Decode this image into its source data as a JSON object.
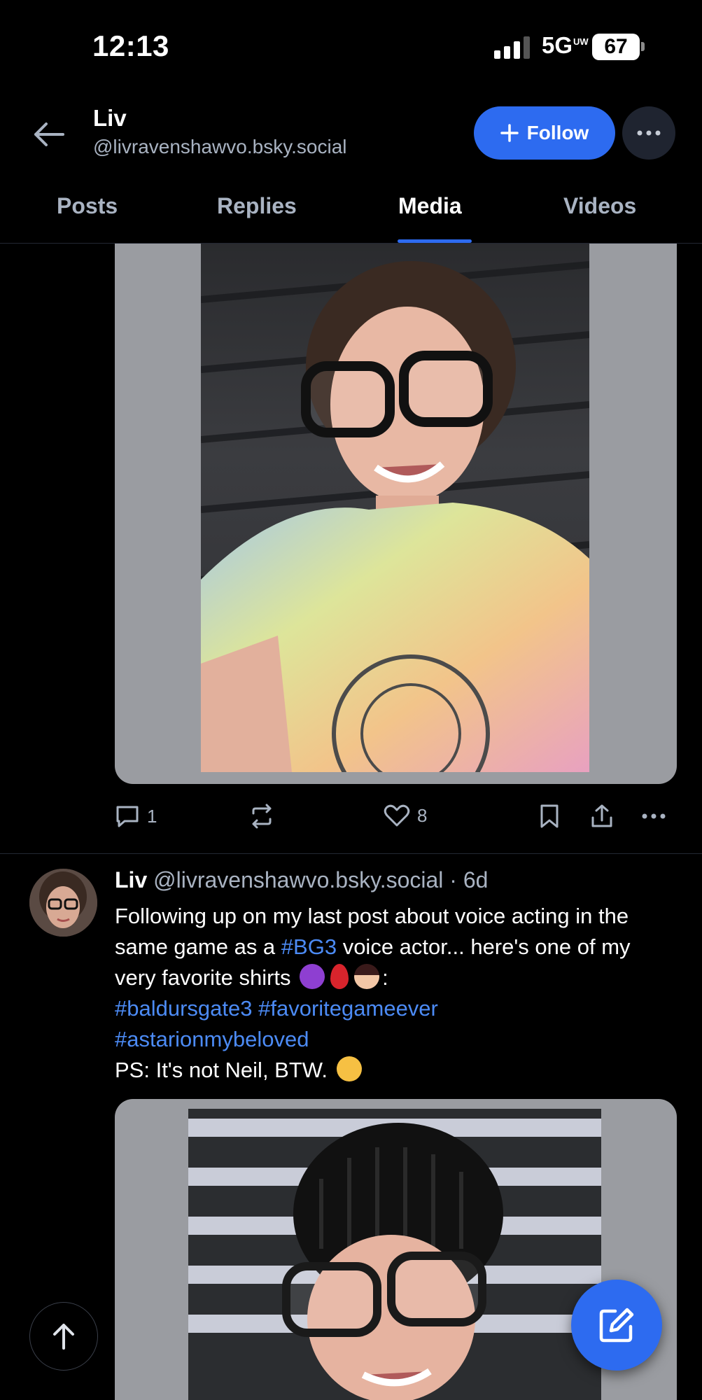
{
  "status_bar": {
    "time": "12:13",
    "network": "5G",
    "network_sup": "UW",
    "battery": "67"
  },
  "header": {
    "name": "Liv",
    "handle": "@livravenshawvo.bsky.social",
    "follow_label": "Follow",
    "back_icon": "arrow-left-icon",
    "more_icon": "ellipsis-icon"
  },
  "tabs": [
    {
      "label": "Posts",
      "active": false
    },
    {
      "label": "Replies",
      "active": false
    },
    {
      "label": "Media",
      "active": true
    },
    {
      "label": "Videos",
      "active": false
    }
  ],
  "post1": {
    "reply_count": "1",
    "like_count": "8",
    "image_description": "Selfie of woman in glasses wearing tie-dye Bring Me The Horizon shirt"
  },
  "post2": {
    "author_name": "Liv",
    "author_handle": "@livravenshawvo.bsky.social",
    "separator": "·",
    "timestamp": "6d",
    "text_part1": "Following up on my last post about voice acting in the same game as a ",
    "tag_bg3": "#BG3",
    "text_part2": " voice actor... here's one of my very favorite shirts ",
    "text_colon": ":",
    "tag_baldursgate3": "#baldursgate3",
    "tag_favoritegameever": "#favoritegameever",
    "tag_astarion": "#astarionmybeloved",
    "text_ps": "PS: It's not Neil, BTW. "
  },
  "colors": {
    "accent": "#2d6bf0",
    "link": "#4c8bf5",
    "muted": "#a9b3c2",
    "background": "#000000"
  }
}
